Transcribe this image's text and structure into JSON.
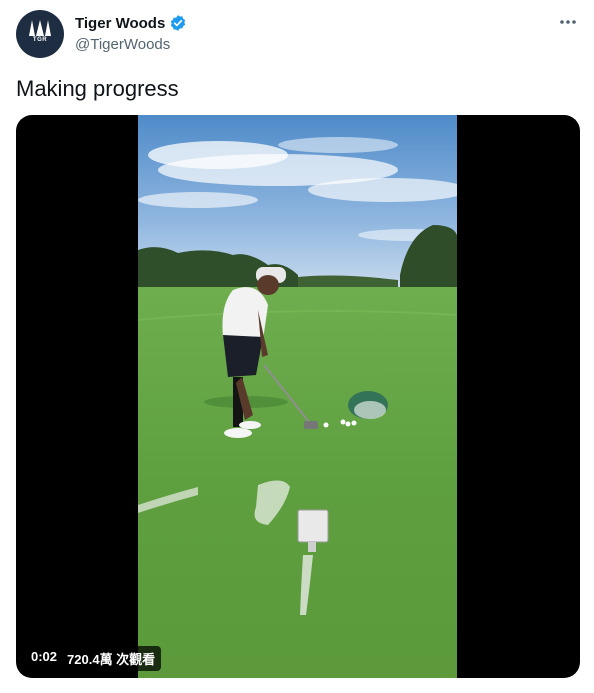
{
  "author": {
    "display_name": "Tiger Woods",
    "handle": "@TigerWoods",
    "avatar_logo_text": "TGR",
    "verified": true
  },
  "tweet": {
    "text": "Making progress"
  },
  "video": {
    "elapsed": "0:02",
    "views": "720.4萬 次觀看",
    "progress_fraction": 0.0
  },
  "colors": {
    "verified_badge": "#1d9bf0",
    "text_primary": "#0f1419",
    "text_secondary": "#536471",
    "avatar_bg": "#1e2d42"
  },
  "icons": [
    "verified-badge-icon",
    "more-options-icon"
  ]
}
